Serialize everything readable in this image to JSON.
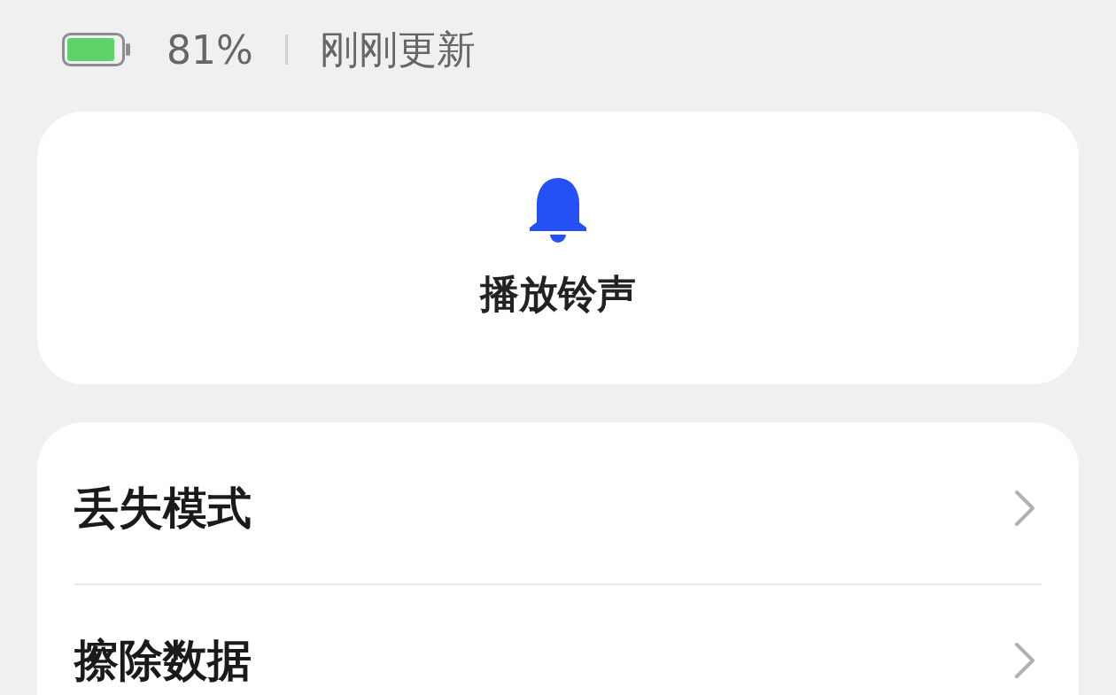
{
  "status": {
    "battery_percent": "81%",
    "updated": "刚刚更新"
  },
  "ring_card": {
    "label": "播放铃声"
  },
  "menu": [
    {
      "label": "丢失模式"
    },
    {
      "label": "擦除数据"
    }
  ]
}
